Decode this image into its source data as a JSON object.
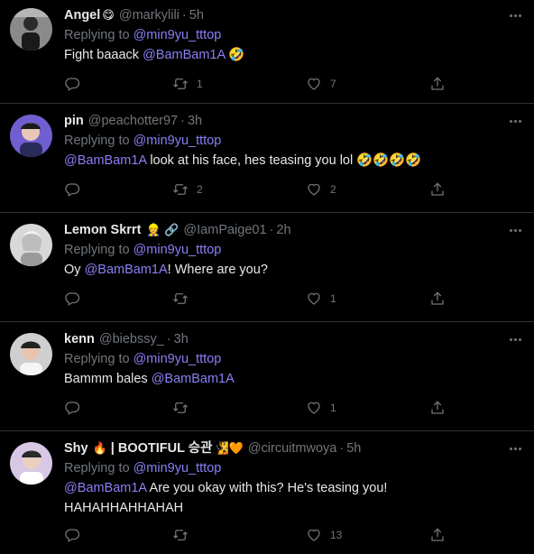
{
  "colors": {
    "background": "#000000",
    "text": "#e7e9ea",
    "muted": "#71767b",
    "mention": "#8b7ff5",
    "divider": "#2f3336"
  },
  "replies": [
    {
      "name": "Angel",
      "name_emoji": "😋",
      "handle": "@markylili",
      "time": "5h",
      "replying_label": "Replying to",
      "replying_to": "@min9yu_tttop",
      "text_before": "Fight baaack ",
      "mention": "@BamBam1A",
      "text_after": " 🤣",
      "stats": {
        "replies": "",
        "retweets": "1",
        "likes": "7"
      }
    },
    {
      "name": "pin",
      "handle": "@peachotter97",
      "time": "3h",
      "replying_label": "Replying to",
      "replying_to": "@min9yu_tttop",
      "mention": "@BamBam1A",
      "text_after": " look at his face, hes teasing you lol 🤣🤣🤣🤣",
      "stats": {
        "replies": "",
        "retweets": "2",
        "likes": "2"
      }
    },
    {
      "name": "Lemon Skrrt",
      "name_emoji": "👷 🔗",
      "handle": "@IamPaige01",
      "time": "2h",
      "replying_label": "Replying to",
      "replying_to": "@min9yu_tttop",
      "text_before": "Oy ",
      "mention": "@BamBam1A",
      "text_after": "! Where are you?",
      "stats": {
        "replies": "",
        "retweets": "",
        "likes": "1"
      }
    },
    {
      "name": "kenn",
      "handle": "@biebssy_",
      "time": "3h",
      "replying_label": "Replying to",
      "replying_to": "@min9yu_tttop",
      "text_before": "Bammm bales ",
      "mention": "@BamBam1A",
      "stats": {
        "replies": "",
        "retweets": "",
        "likes": "1"
      }
    },
    {
      "name": "Shy",
      "name_emoji": "🔥",
      "name_suffix": " | BOOTIFUL 승관",
      "name_suffix_emoji": "🧏🧡",
      "handle": "@circuitmwoya",
      "time": "5h",
      "replying_label": "Replying to",
      "replying_to": "@min9yu_tttop",
      "mention": "@BamBam1A",
      "text_after": " Are you okay with this? He's teasing you!",
      "text_line2": "HAHAHHAHHAHAH",
      "stats": {
        "replies": "",
        "retweets": "",
        "likes": "13"
      }
    }
  ],
  "dot_separator": "·"
}
